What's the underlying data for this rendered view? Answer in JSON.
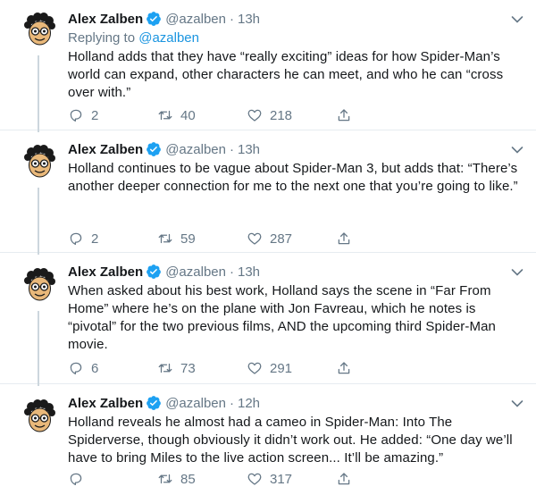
{
  "colors": {
    "link": "#1b95e0",
    "muted": "#657786",
    "verified": "#1da1f2",
    "text": "#14171a"
  },
  "icons": {
    "reply": "speech-bubble-icon",
    "retweet": "retweet-arrows-icon",
    "like": "heart-icon",
    "share": "share-upload-icon",
    "caret": "chevron-down-icon",
    "verified": "verified-badge-icon"
  },
  "tweets": [
    {
      "name": "Alex Zalben",
      "handle": "@azalben",
      "dot": "·",
      "time": "13h",
      "reply_prefix": "Replying to ",
      "reply_to": "@azalben",
      "text": "Holland adds that they have “really exciting” ideas for how Spider-Man’s world can expand, other characters he can meet, and who he can “cross over with.”",
      "replies": "2",
      "retweets": "40",
      "likes": "218"
    },
    {
      "name": "Alex Zalben",
      "handle": "@azalben",
      "dot": "·",
      "time": "13h",
      "text": "Holland continues to be vague about Spider-Man 3, but adds that: “There’s another deeper connection for me to the next one that you’re going to like.”",
      "replies": "2",
      "retweets": "59",
      "likes": "287"
    },
    {
      "name": "Alex Zalben",
      "handle": "@azalben",
      "dot": "·",
      "time": "13h",
      "text": "When asked about his best work, Holland says the scene in “Far From Home” where he’s on the plane with Jon Favreau, which he notes is “pivotal” for the two previous films, AND the upcoming third Spider-Man movie.",
      "replies": "6",
      "retweets": "73",
      "likes": "291"
    },
    {
      "name": "Alex Zalben",
      "handle": "@azalben",
      "dot": "·",
      "time": "12h",
      "text": "Holland reveals he almost had a cameo in Spider-Man: Into The Spiderverse, though obviously it didn’t work out. He added: “One day we’ll have to bring Miles to the live action screen... It’ll be amazing.”",
      "replies": "",
      "retweets": "85",
      "likes": "317"
    }
  ]
}
